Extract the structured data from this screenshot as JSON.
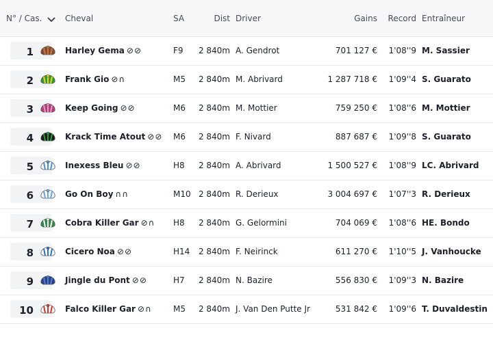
{
  "header": {
    "num_cas": "N° / Cas.",
    "cheval": "Cheval",
    "sa": "SA",
    "dist": "Dist",
    "driver": "Driver",
    "gains": "Gains",
    "record": "Record",
    "entraineur": "Entraîneur"
  },
  "rows": [
    {
      "num": "1",
      "name": "Harley Gema",
      "shoes": "⊘⊘",
      "sa": "F9",
      "dist": "2 840m",
      "driver": "A. Gendrot",
      "gains": "701 127 €",
      "record": "1'08''9",
      "trainer": "M. Sassier"
    },
    {
      "num": "2",
      "name": "Frank Gio",
      "shoes": "⊘∩",
      "sa": "M5",
      "dist": "2 840m",
      "driver": "M. Abrivard",
      "gains": "1 287 718 €",
      "record": "1'09''4",
      "trainer": "S. Guarato"
    },
    {
      "num": "3",
      "name": "Keep Going",
      "shoes": "⊘⊘",
      "sa": "M6",
      "dist": "2 840m",
      "driver": "M. Mottier",
      "gains": "759 250 €",
      "record": "1'08''6",
      "trainer": "M. Mottier"
    },
    {
      "num": "4",
      "name": "Krack Time Atout",
      "shoes": "⊘⊘",
      "sa": "M6",
      "dist": "2 840m",
      "driver": "F. Nivard",
      "gains": "887 687 €",
      "record": "1'09''8",
      "trainer": "S. Guarato"
    },
    {
      "num": "5",
      "name": "Inexess Bleu",
      "shoes": "⊘⊘",
      "sa": "H8",
      "dist": "2 840m",
      "driver": "A. Abrivard",
      "gains": "1 500 527 €",
      "record": "1'08''9",
      "trainer": "LC. Abrivard"
    },
    {
      "num": "6",
      "name": "Go On Boy",
      "shoes": "∩∩",
      "sa": "M10",
      "dist": "2 840m",
      "driver": "R. Derieux",
      "gains": "3 004 697 €",
      "record": "1'07''3",
      "trainer": "R. Derieux"
    },
    {
      "num": "7",
      "name": "Cobra Killer Gar",
      "shoes": "⊘∩",
      "sa": "H8",
      "dist": "2 840m",
      "driver": "G. Gelormini",
      "gains": "704 069 €",
      "record": "1'08''6",
      "trainer": "HE. Bondo"
    },
    {
      "num": "8",
      "name": "Cicero Noa",
      "shoes": "⊘⊘",
      "sa": "H14",
      "dist": "2 840m",
      "driver": "F. Neirinck",
      "gains": "611 270 €",
      "record": "1'10''5",
      "trainer": "J. Vanhoucke"
    },
    {
      "num": "9",
      "name": "Jingle du Pont",
      "shoes": "⊘⊘",
      "sa": "H7",
      "dist": "2 840m",
      "driver": "N. Bazire",
      "gains": "556 830 €",
      "record": "1'09''3",
      "trainer": "N. Bazire"
    },
    {
      "num": "10",
      "name": "Falco Killer Gar",
      "shoes": "⊘∩",
      "sa": "M5",
      "dist": "2 840m",
      "driver": "J. Van Den Putte Jr",
      "gains": "531 842 €",
      "record": "1'09''6",
      "trainer": "T. Duvaldestin"
    }
  ],
  "silks": [
    {
      "icon": "jockey-silk-brown-icon",
      "colors": [
        "#8a4a2a",
        "#c07a4a"
      ]
    },
    {
      "icon": "jockey-silk-green-yellow-icon",
      "colors": [
        "#2f9a3a",
        "#f2d21a"
      ]
    },
    {
      "icon": "jockey-silk-magenta-icon",
      "colors": [
        "#b83a7a",
        "#e0a0c6"
      ]
    },
    {
      "icon": "jockey-silk-black-green-icon",
      "colors": [
        "#1a1a1a",
        "#2e9a3e"
      ]
    },
    {
      "icon": "jockey-silk-blue-white-stripes-icon",
      "colors": [
        "#ffffff",
        "#4a8fd6"
      ]
    },
    {
      "icon": "jockey-silk-white-blue-dots-icon",
      "colors": [
        "#f4f8fc",
        "#6aa4d8"
      ]
    },
    {
      "icon": "jockey-silk-green-white-hoops-icon",
      "colors": [
        "#2f8a4a",
        "#ffffff"
      ]
    },
    {
      "icon": "jockey-silk-white-blue-icon",
      "colors": [
        "#ffffff",
        "#2a6ec8"
      ]
    },
    {
      "icon": "jockey-silk-navy-blue-icon",
      "colors": [
        "#24428a",
        "#5a7cc8"
      ]
    },
    {
      "icon": "jockey-silk-white-red-icon",
      "colors": [
        "#ffffff",
        "#d8302a"
      ]
    }
  ]
}
